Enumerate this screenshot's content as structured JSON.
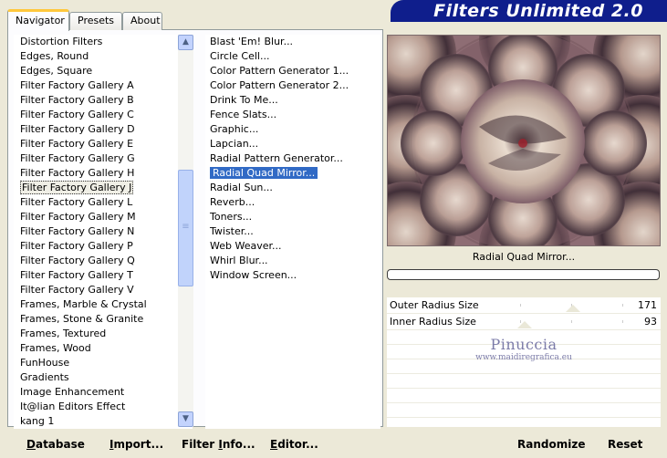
{
  "tabs": [
    {
      "label": "Navigator",
      "active": true
    },
    {
      "label": "Presets",
      "active": false
    },
    {
      "label": "About",
      "active": false
    }
  ],
  "banner": {
    "title": "Filters Unlimited 2.0"
  },
  "categories": {
    "items": [
      "Distortion Filters",
      "Edges, Round",
      "Edges, Square",
      "Filter Factory Gallery A",
      "Filter Factory Gallery B",
      "Filter Factory Gallery C",
      "Filter Factory Gallery D",
      "Filter Factory Gallery E",
      "Filter Factory Gallery G",
      "Filter Factory Gallery H",
      "Filter Factory Gallery J",
      "Filter Factory Gallery L",
      "Filter Factory Gallery M",
      "Filter Factory Gallery N",
      "Filter Factory Gallery P",
      "Filter Factory Gallery Q",
      "Filter Factory Gallery T",
      "Filter Factory Gallery V",
      "Frames, Marble & Crystal",
      "Frames, Stone & Granite",
      "Frames, Textured",
      "Frames, Wood",
      "FunHouse",
      "Gradients",
      "Image Enhancement",
      "It@lian Editors Effect",
      "kang 1"
    ],
    "selected": "Filter Factory Gallery J"
  },
  "filters": {
    "items": [
      "Blast 'Em! Blur...",
      "Circle Cell...",
      "Color Pattern Generator 1...",
      "Color Pattern Generator 2...",
      "Drink To Me...",
      "Fence Slats...",
      "Graphic...",
      "Lapcian...",
      "Radial Pattern Generator...",
      "Radial Quad Mirror...",
      "Radial Sun...",
      "Reverb...",
      "Toners...",
      "Twister...",
      "Web Weaver...",
      "Whirl Blur...",
      "Window Screen..."
    ],
    "selected": "Radial Quad Mirror..."
  },
  "preview": {
    "filter_name": "Radial Quad Mirror..."
  },
  "params": [
    {
      "label": "Outer Radius Size",
      "value": "171",
      "level": 0.67
    },
    {
      "label": "Inner Radius Size",
      "value": "93",
      "level": 0.36
    }
  ],
  "watermark": {
    "name": "Pinuccia",
    "url": "www.maidiregrafica.eu"
  },
  "buttons": {
    "database": {
      "prefix": "D",
      "rest": "atabase"
    },
    "import": {
      "prefix": "I",
      "rest": "mport..."
    },
    "filter_info": {
      "pre": "Filter ",
      "prefix": "I",
      "rest": "nfo..."
    },
    "editor": {
      "prefix": "E",
      "rest": "ditor..."
    },
    "randomize": "Randomize",
    "reset": "Reset"
  },
  "colors": {
    "banner": "#0f1e8c",
    "selection": "#316ac5",
    "tab_accent": "#ffc83c"
  }
}
